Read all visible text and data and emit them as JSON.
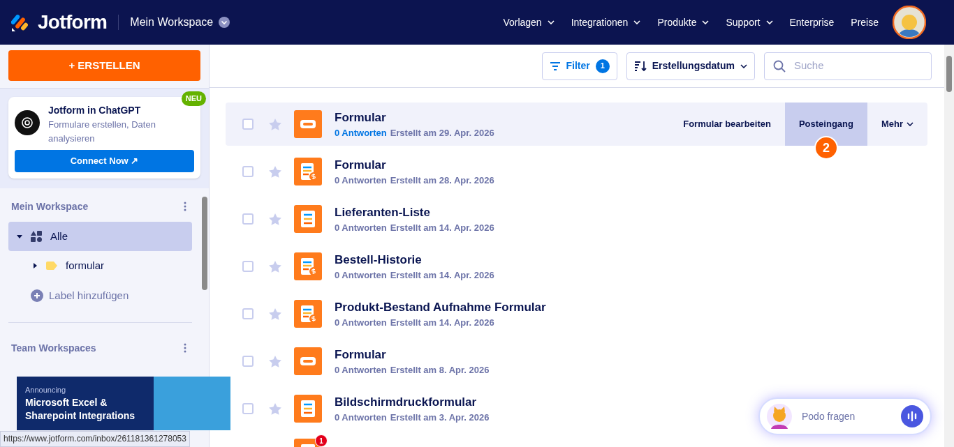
{
  "header": {
    "logo": "Jotform",
    "workspace": "Mein Workspace",
    "nav": [
      {
        "label": "Vorlagen",
        "dropdown": true
      },
      {
        "label": "Integrationen",
        "dropdown": true
      },
      {
        "label": "Produkte",
        "dropdown": true
      },
      {
        "label": "Support",
        "dropdown": true
      },
      {
        "label": "Enterprise",
        "dropdown": false
      },
      {
        "label": "Preise",
        "dropdown": false
      }
    ]
  },
  "sidebar": {
    "create_button": "+ ERSTELLEN",
    "promo": {
      "badge": "NEU",
      "title": "Jotform in ChatGPT",
      "text": "Formulare erstellen, Daten analysieren",
      "button": "Connect Now ↗"
    },
    "workspace_title": "Mein Workspace",
    "tree": [
      {
        "label": "Alle",
        "selected": true,
        "expanded": true,
        "children": [
          {
            "label": "formular",
            "selected": false,
            "expanded": false
          }
        ]
      }
    ],
    "add_label": "Label hinzufügen",
    "team_title": "Team Workspaces",
    "banner": {
      "kicker": "Announcing",
      "title": "Microsoft Excel & Sharepoint Integrations"
    }
  },
  "toolbar": {
    "filter": "Filter",
    "filter_count": "1",
    "sort": "Erstellungsdatum",
    "search_placeholder": "Suche"
  },
  "forms": [
    {
      "title": "Formular",
      "responses": "0 Antworten",
      "created": "Erstellt am 29. Apr. 2026",
      "kind": "card",
      "hovered": true,
      "checked": false,
      "starred": false,
      "actions": [
        {
          "label": "Formular bearbeiten",
          "selected": false
        },
        {
          "label": "Posteingang",
          "selected": true,
          "badge": "2"
        },
        {
          "label": "Mehr",
          "selected": false,
          "dropdown": true
        }
      ]
    },
    {
      "title": "Formular",
      "responses": "0 Antworten",
      "created": "Erstellt am 28. Apr. 2026",
      "kind": "payment",
      "hovered": false,
      "checked": false,
      "starred": false
    },
    {
      "title": "Lieferanten-Liste",
      "responses": "0 Antworten",
      "created": "Erstellt am 14. Apr. 2026",
      "kind": "list",
      "hovered": false,
      "checked": false,
      "starred": false
    },
    {
      "title": "Bestell-Historie",
      "responses": "0 Antworten",
      "created": "Erstellt am 14. Apr. 2026",
      "kind": "payment",
      "hovered": false,
      "checked": false,
      "starred": false
    },
    {
      "title": "Produkt-Bestand Aufnahme Formular",
      "responses": "0 Antworten",
      "created": "Erstellt am 14. Apr. 2026",
      "kind": "payment",
      "hovered": false,
      "checked": false,
      "starred": false
    },
    {
      "title": "Formular",
      "responses": "0 Antworten",
      "created": "Erstellt am 8. Apr. 2026",
      "kind": "card",
      "hovered": false,
      "checked": false,
      "starred": false
    },
    {
      "title": "Bildschirmdruckformular",
      "responses": "0 Antworten",
      "created": "Erstellt am 3. Apr. 2026",
      "kind": "list",
      "hovered": false,
      "checked": false,
      "starred": false
    },
    {
      "kind": "list",
      "badge": "1"
    }
  ],
  "assistant": {
    "placeholder": "Podo fragen"
  },
  "status_url": "https://www.jotform.com/inbox/261181361278053"
}
